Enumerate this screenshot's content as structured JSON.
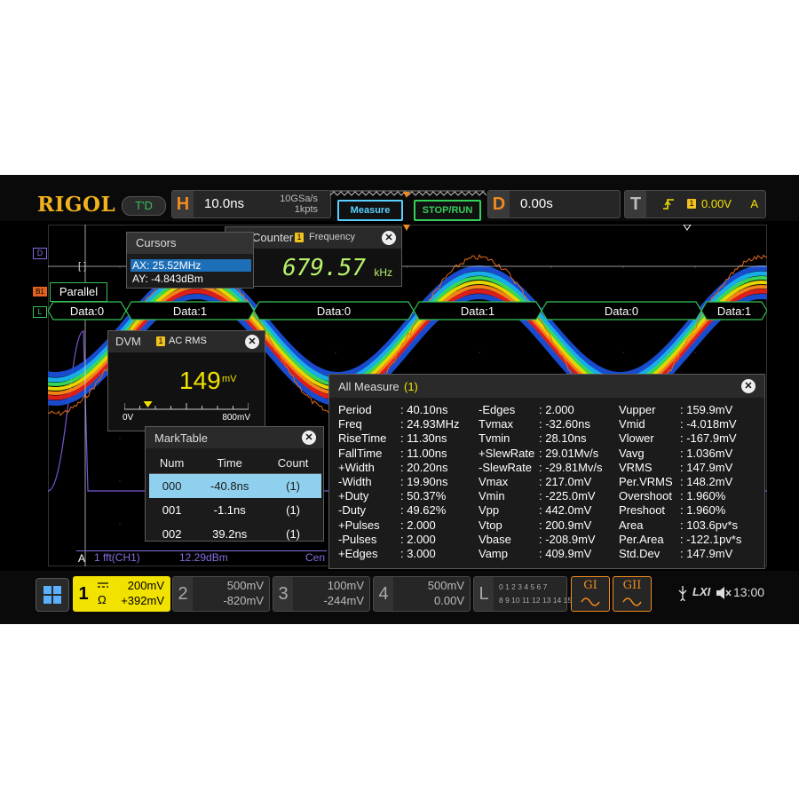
{
  "brand": "RIGOL",
  "mode_badge": "T'D",
  "horizontal": {
    "letter": "H",
    "timebase": "10.0ns",
    "sample_rate": "10GSa/s",
    "depth": "1kpts"
  },
  "buttons": {
    "measure": "Measure",
    "stop_run": "STOP/RUN"
  },
  "delay": {
    "letter": "D",
    "value": "0.00s"
  },
  "trigger": {
    "letter": "T",
    "edge_icon": "rising-edge-icon",
    "channel": "1",
    "level": "0.00V",
    "mode": "A"
  },
  "left_markers": {
    "d": "D",
    "b1": "B1",
    "l": "L"
  },
  "bus": {
    "label": "Parallel",
    "segments": [
      "Data:0",
      "Data:1",
      "Data:0",
      "Data:1",
      "Data:0",
      "Data:1"
    ]
  },
  "cursors": {
    "title": "Cursors",
    "ax": "AX: 25.52MHz",
    "ay": "AY: -4.843dBm",
    "marker": "[ ]"
  },
  "counter": {
    "title": "Counter",
    "channel": "1",
    "mode": "Frequency",
    "value": "679.57",
    "unit": "kHz"
  },
  "dvm": {
    "title": "DVM",
    "channel": "1",
    "mode": "AC RMS",
    "value": "149",
    "unit": "mV",
    "scale_min": "0V",
    "scale_max": "800mV",
    "level_fraction": 0.19
  },
  "marktable": {
    "title": "MarkTable",
    "headers": [
      "Num",
      "Time",
      "Count"
    ],
    "rows": [
      {
        "num": "000",
        "time": "-40.8ns",
        "count": "(1)",
        "selected": true
      },
      {
        "num": "001",
        "time": "-1.1ns",
        "count": "(1)",
        "selected": false
      },
      {
        "num": "002",
        "time": "39.2ns",
        "count": "(1)",
        "selected": false
      }
    ]
  },
  "fft_label": {
    "marker": "A",
    "source": "1 fft(CH1)",
    "level": "12.29dBm",
    "center": "Cen"
  },
  "all_measure": {
    "title": "All Measure",
    "channel": "(1)",
    "columns": [
      [
        {
          "label": "Period",
          "value": ": 40.10ns"
        },
        {
          "label": "Freq",
          "value": ": 24.93MHz"
        },
        {
          "label": "RiseTime",
          "value": ": 11.30ns"
        },
        {
          "label": "FallTime",
          "value": ": 11.00ns"
        },
        {
          "label": "+Width",
          "value": ": 20.20ns"
        },
        {
          "label": "-Width",
          "value": ": 19.90ns"
        },
        {
          "label": "+Duty",
          "value": ": 50.37%"
        },
        {
          "label": "-Duty",
          "value": ": 49.62%"
        },
        {
          "label": "+Pulses",
          "value": ": 2.000"
        },
        {
          "label": "-Pulses",
          "value": ": 2.000"
        },
        {
          "label": "+Edges",
          "value": ": 3.000"
        }
      ],
      [
        {
          "label": "-Edges",
          "value": ": 2.000"
        },
        {
          "label": "Tvmax",
          "value": ": -32.60ns"
        },
        {
          "label": "Tvmin",
          "value": ": 28.10ns"
        },
        {
          "label": "+SlewRate",
          "value": ": 29.01Mv/s"
        },
        {
          "label": "-SlewRate",
          "value": ": -29.81Mv/s"
        },
        {
          "label": "Vmax",
          "value": ": 217.0mV"
        },
        {
          "label": "Vmin",
          "value": ": -225.0mV"
        },
        {
          "label": "Vpp",
          "value": ": 442.0mV"
        },
        {
          "label": "Vtop",
          "value": ": 200.9mV"
        },
        {
          "label": "Vbase",
          "value": ": -208.9mV"
        },
        {
          "label": "Vamp",
          "value": ": 409.9mV"
        }
      ],
      [
        {
          "label": "Vupper",
          "value": ": 159.9mV"
        },
        {
          "label": "Vmid",
          "value": ": -4.018mV"
        },
        {
          "label": "Vlower",
          "value": ": -167.9mV"
        },
        {
          "label": "Vavg",
          "value": ": 1.036mV"
        },
        {
          "label": "VRMS",
          "value": ": 147.9mV"
        },
        {
          "label": "Per.VRMS",
          "value": ": 148.2mV"
        },
        {
          "label": "Overshoot",
          "value": ": 1.960%"
        },
        {
          "label": "Preshoot",
          "value": ": 1.960%"
        },
        {
          "label": "Area",
          "value": ": 103.6pv*s"
        },
        {
          "label": "Per.Area",
          "value": ": -122.1pv*s"
        },
        {
          "label": "Std.Dev",
          "value": ": 147.9mV"
        }
      ]
    ]
  },
  "channels": [
    {
      "num": "1",
      "scale": "200mV",
      "offset": "+392mV",
      "impedance": "Ω",
      "active": true
    },
    {
      "num": "2",
      "scale": "500mV",
      "offset": "-820mV",
      "active": false
    },
    {
      "num": "3",
      "scale": "100mV",
      "offset": "-244mV",
      "active": false
    },
    {
      "num": "4",
      "scale": "500mV",
      "offset": "0.00V",
      "active": false
    }
  ],
  "logic": {
    "letter": "L",
    "row1": "0 1 2 3  4 5 6 7",
    "row2": "8 9 10 11 12 13 14 15"
  },
  "generators": [
    {
      "label": "GI"
    },
    {
      "label": "GII"
    }
  ],
  "status": {
    "usb_icon": "usb-icon",
    "lxi": "LXI",
    "speaker_icon": "speaker-muted-icon",
    "time": "13:00"
  },
  "colors": {
    "ch1": "#f2e200",
    "accent": "#f2b21f",
    "bus": "#35c25a",
    "ch_orange": "#ff7a1a"
  }
}
